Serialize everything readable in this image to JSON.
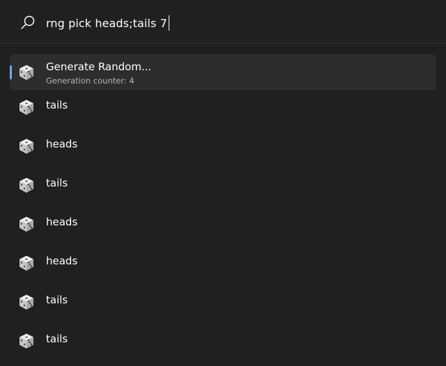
{
  "search": {
    "query": "rng pick heads;tails 7"
  },
  "results": {
    "top": {
      "title": "Generate Random...",
      "subtitle": "Generation counter: 4",
      "icon": "dice-icon"
    },
    "items": [
      {
        "label": "tails",
        "icon": "dice-icon"
      },
      {
        "label": "heads",
        "icon": "dice-icon"
      },
      {
        "label": "tails",
        "icon": "dice-icon"
      },
      {
        "label": "heads",
        "icon": "dice-icon"
      },
      {
        "label": "heads",
        "icon": "dice-icon"
      },
      {
        "label": "tails",
        "icon": "dice-icon"
      },
      {
        "label": "tails",
        "icon": "dice-icon"
      }
    ]
  },
  "colors": {
    "background": "#202020",
    "selected_background": "#2d2d2d",
    "accent": "#7aa7ee",
    "text": "#ffffff",
    "subtext": "#b5b5b5"
  }
}
